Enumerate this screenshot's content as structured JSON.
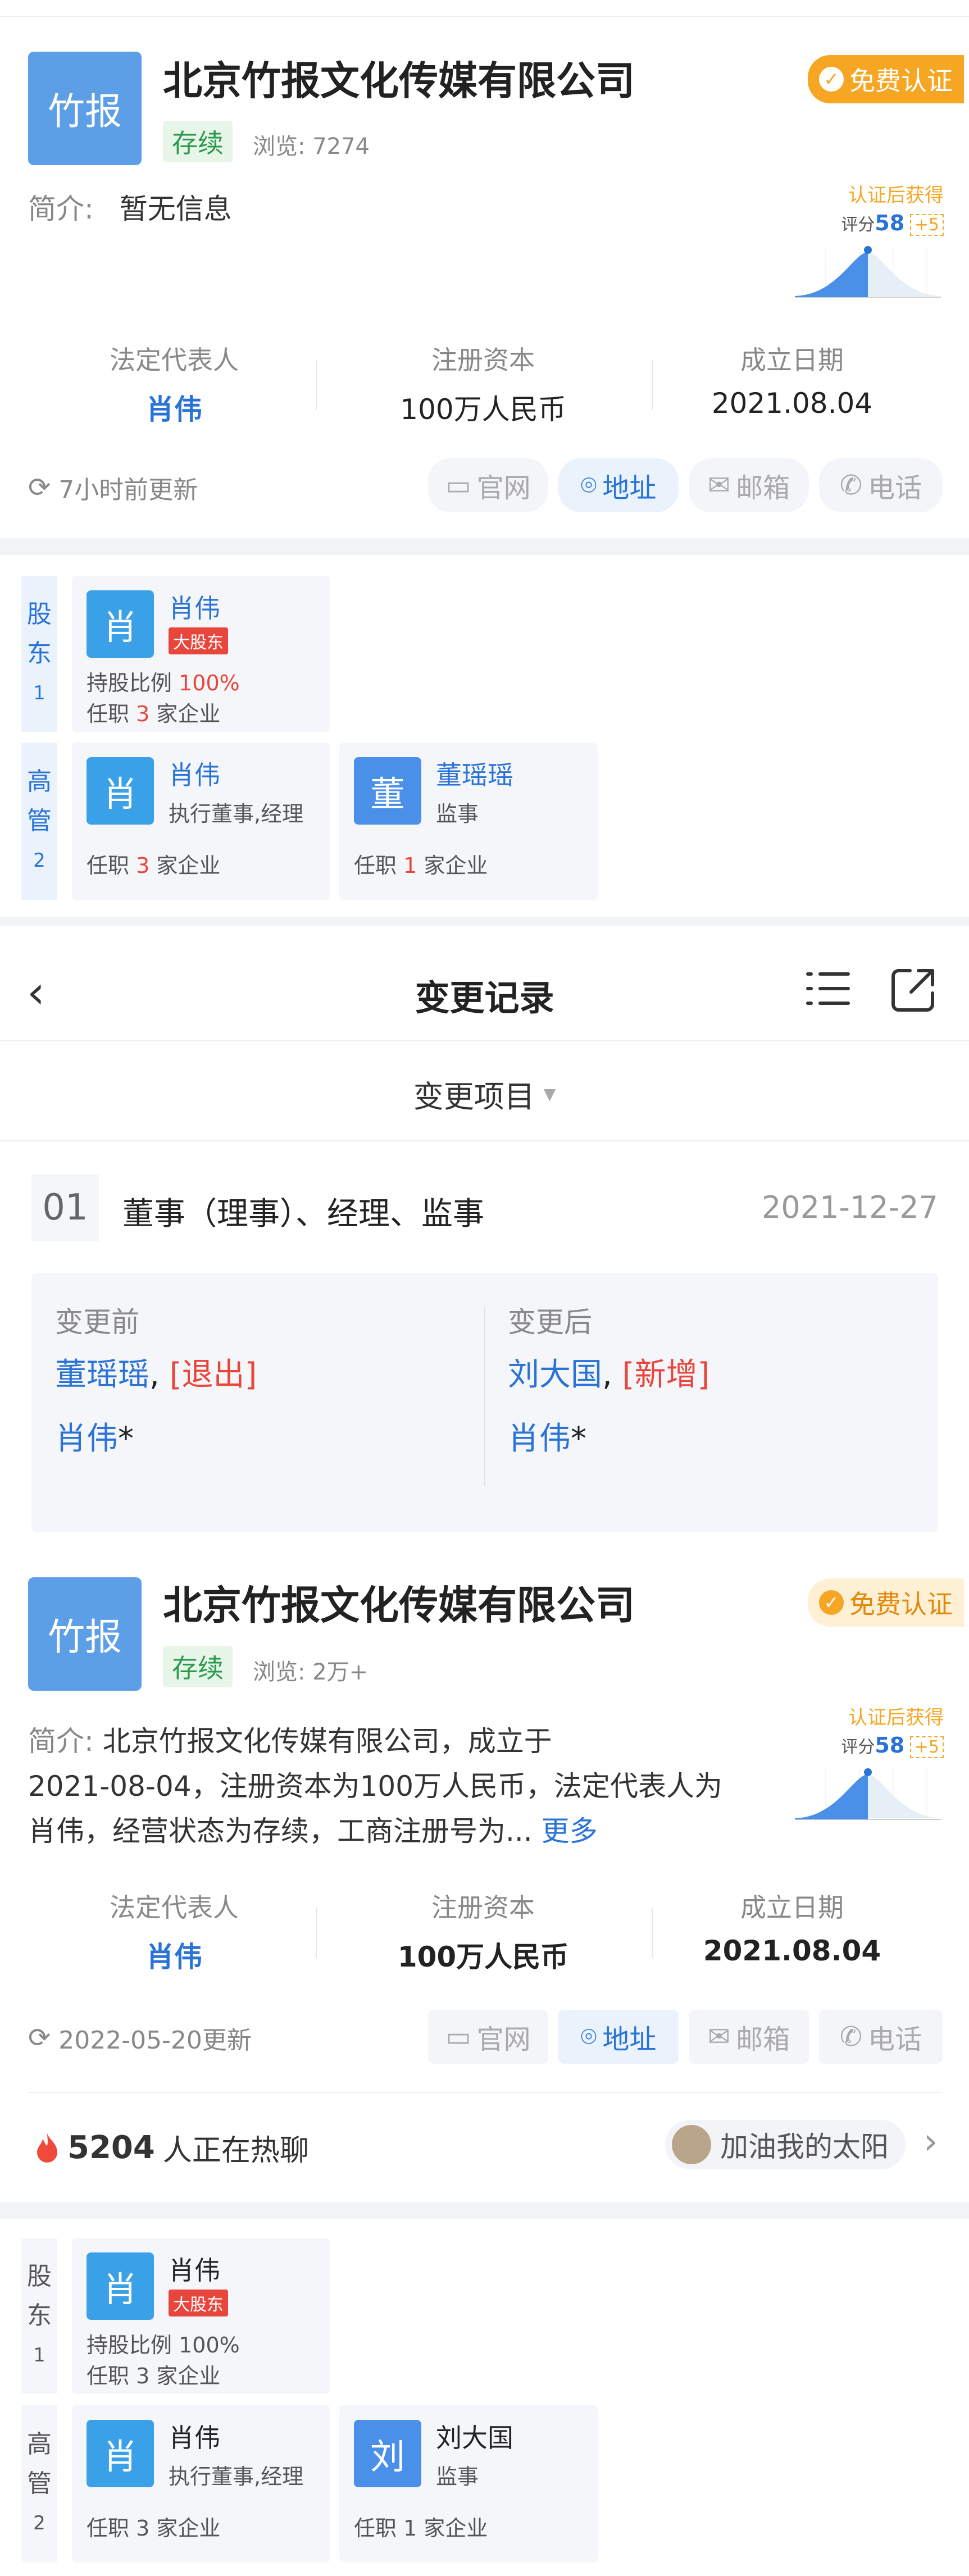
{
  "card1": {
    "logo": "竹报",
    "name": "北京竹报文化传媒有限公司",
    "status": "存续",
    "views": "浏览: 7274",
    "cert": "免费认证",
    "intro_label": "简介:",
    "intro_text": "暂无信息",
    "fig_title": "认证后获得",
    "fig_score_label": "评分",
    "fig_score": "58",
    "fig_plus": "+5",
    "stats": [
      {
        "label": "法定代表人",
        "value": "肖伟"
      },
      {
        "label": "注册资本",
        "value": "100万人民币"
      },
      {
        "label": "成立日期",
        "value": "2021.08.04"
      }
    ],
    "updated": "7小时前更新",
    "chips": {
      "web": "官网",
      "addr": "地址",
      "mail": "邮箱",
      "phone": "电话"
    }
  },
  "people1": {
    "shareholder_col": [
      "股",
      "东",
      "1"
    ],
    "exec_col": [
      "高",
      "管",
      "2"
    ],
    "shareholder": {
      "avatar": "肖",
      "name": "肖伟",
      "tag": "大股东",
      "ratio_label": "持股比例 ",
      "ratio": "100%",
      "jobs_pre": "任职 ",
      "jobs_n": "3",
      "jobs_post": " 家企业"
    },
    "exec": [
      {
        "avatar": "肖",
        "name": "肖伟",
        "role": "执行董事,经理",
        "jobs_pre": "任职 ",
        "jobs_n": "3",
        "jobs_post": " 家企业"
      },
      {
        "avatar": "董",
        "name": "董瑶瑶",
        "role": "监事",
        "jobs_pre": "任职 ",
        "jobs_n": "1",
        "jobs_post": " 家企业"
      }
    ]
  },
  "changes": {
    "title": "变更记录",
    "filter": "变更项目",
    "num": "01",
    "item": "董事（理事）、经理、监事",
    "date": "2021-12-27",
    "before_label": "变更前",
    "after_label": "变更后",
    "before": [
      {
        "name": "董瑶瑶",
        "sep": ", ",
        "note": "[退出]"
      },
      {
        "name": "肖伟",
        "sep": "",
        "note": "*"
      }
    ],
    "after": [
      {
        "name": "刘大国",
        "sep": ", ",
        "note": "[新增]"
      },
      {
        "name": "肖伟",
        "sep": "",
        "note": "*"
      }
    ]
  },
  "card2": {
    "logo": "竹报",
    "name": "北京竹报文化传媒有限公司",
    "status": "存续",
    "views": "浏览: 2万+",
    "cert": "免费认证",
    "intro_label": "简介:",
    "intro_line1": "北京竹报文化传媒有限公司，成立于",
    "intro_line2": "2021-08-04，注册资本为100万人民币，法定代表人为",
    "intro_line3": "肖伟，经营状态为存续，工商注册号为...",
    "more": "更多",
    "fig_title": "认证后获得",
    "fig_score_label": "评分",
    "fig_score": "58",
    "fig_plus": "+5",
    "stats": [
      {
        "label": "法定代表人",
        "value": "肖伟"
      },
      {
        "label": "注册资本",
        "value": "100万人民币"
      },
      {
        "label": "成立日期",
        "value": "2021.08.04"
      }
    ],
    "updated": "2022-05-20更新",
    "chips": {
      "web": "官网",
      "addr": "地址",
      "mail": "邮箱",
      "phone": "电话"
    },
    "hot_count": "5204",
    "hot_text": "人正在热聊",
    "user": "加油我的太阳"
  },
  "people2": {
    "shareholder_col": [
      "股",
      "东",
      "1"
    ],
    "exec_col": [
      "高",
      "管",
      "2"
    ],
    "shareholder": {
      "avatar": "肖",
      "name": "肖伟",
      "tag": "大股东",
      "ratio_label": "持股比例 ",
      "ratio": "100%",
      "jobs_pre": "任职 ",
      "jobs_n": "3",
      "jobs_post": " 家企业"
    },
    "exec": [
      {
        "avatar": "肖",
        "name": "肖伟",
        "role": "执行董事,经理",
        "jobs_pre": "任职 ",
        "jobs_n": "3",
        "jobs_post": " 家企业"
      },
      {
        "avatar": "刘",
        "name": "刘大国",
        "role": "监事",
        "jobs_pre": "任职 ",
        "jobs_n": "1",
        "jobs_post": " 家企业"
      }
    ]
  },
  "colors": {
    "blue": "#2a73d6",
    "orange": "#f6a623",
    "green": "#2a9a4c",
    "red": "#e8463c"
  }
}
